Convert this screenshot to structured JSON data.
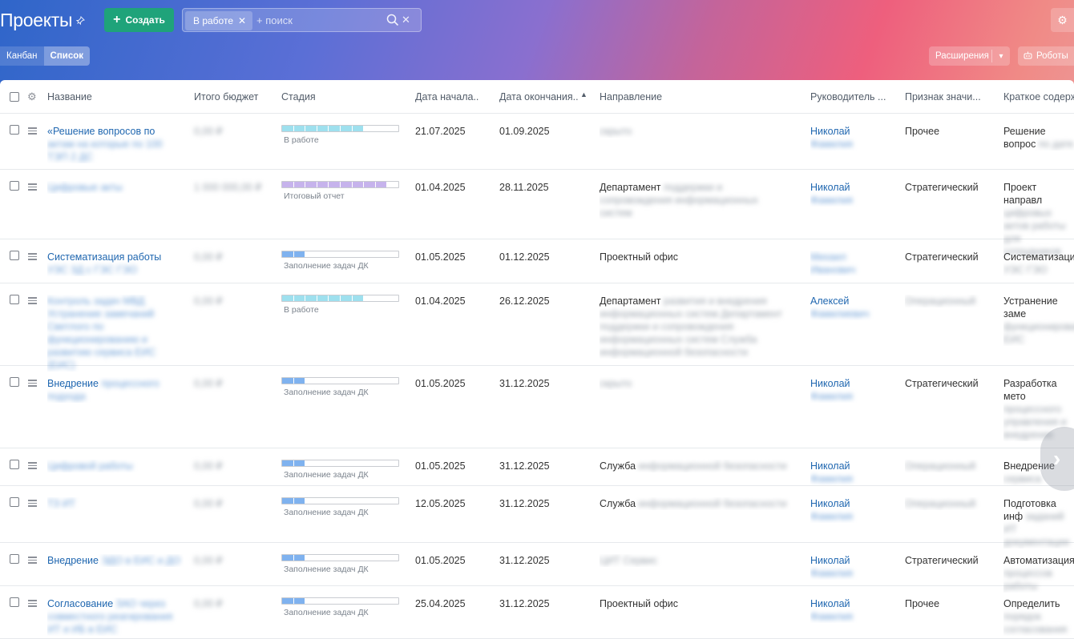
{
  "header": {
    "title": "Проекты",
    "create_label": "Создать",
    "filter_tag": "В работе",
    "search_placeholder": "+ поиск",
    "views": [
      "Канбан",
      "Список"
    ],
    "extensions_label": "Расширения",
    "robots_label": "Роботы"
  },
  "colors": {
    "accent_create": "#1fa37a",
    "link": "#2067b0",
    "stage_work": "#9ee0ee",
    "stage_report": "#c6b3ec",
    "stage_fill": "#7fb2ef"
  },
  "table": {
    "columns": [
      "Название",
      "Итого бюджет",
      "Стадия",
      "Дата начала...",
      "Дата окончания...",
      "Направление",
      "Руководитель ...",
      "Признак значи...",
      "Краткое содерж"
    ],
    "rows": [
      {
        "name": "«Решение вопросов по",
        "name_hidden": "актам на которые по 100 ТЭП 2 ДС",
        "budget": "0,00 ₽",
        "stage": "В работе",
        "start": "21.07.2025",
        "end": "01.09.2025",
        "direction": "",
        "direction_hidden": "скрыто",
        "manager": "Николай",
        "manager_hidden": "Фамилия",
        "sign": "Прочее",
        "summary": "Решение вопрос",
        "summary_hidden": "по дате"
      },
      {
        "name": "",
        "name_hidden": "Цифровые акты",
        "budget": "1 000 000,00 ₽",
        "stage": "Итоговый отчет",
        "start": "01.04.2025",
        "end": "28.11.2025",
        "direction": "Департамент",
        "direction_hidden": "поддержки и сопровождения информационных систем",
        "manager": "Николай",
        "manager_hidden": "Фамилия",
        "sign": "Стратегический",
        "summary": "Проект направл",
        "summary_hidden": "цифровых актов работы для сотрудников"
      },
      {
        "name": "Систематизация работы",
        "name_hidden": "УЭС ЗД с ГЭС ГЭО",
        "budget": "0,00 ₽",
        "stage": "Заполнение задач ДК",
        "start": "01.05.2025",
        "end": "01.12.2025",
        "direction": "Проектный офис",
        "direction_hidden": "",
        "manager": "",
        "manager_hidden": "Михаил Иванович",
        "sign": "Стратегический",
        "summary": "Систематизация",
        "summary_hidden": "УЭС ГЭО"
      },
      {
        "name": "",
        "name_hidden": "Контроль задач МВД Устранение замечаний Светлого по функционированию и развитию сервиса ЕИС (ЕИС)",
        "budget": "0,00 ₽",
        "stage": "В работе",
        "start": "01.04.2025",
        "end": "26.12.2025",
        "direction": "Департамент",
        "direction_hidden": "развития и внедрения информационных систем Департамент поддержки и сопровождения информационных систем Служба информационной безопасности",
        "manager": "Алексей",
        "manager_hidden": "Фамилиевич",
        "sign": "",
        "sign_hidden": "Операционный",
        "summary": "Устранение заме",
        "summary_hidden": "функционирования ЕИС"
      },
      {
        "name": "Внедрение",
        "name_hidden": "процессного подхода",
        "budget": "0,00 ₽",
        "stage": "Заполнение задач ДК",
        "start": "01.05.2025",
        "end": "31.12.2025",
        "direction": "",
        "direction_hidden": "скрыто",
        "manager": "Николай",
        "manager_hidden": "Фамилия",
        "sign": "Стратегический",
        "summary": "Разработка мето",
        "summary_hidden": "процессного управления и внедрение"
      },
      {
        "name": "",
        "name_hidden": "Цифровой работы",
        "budget": "0,00 ₽",
        "stage": "Заполнение задач ДК",
        "start": "01.05.2025",
        "end": "31.12.2025",
        "direction": "Служба",
        "direction_hidden": "информационной безопасности",
        "manager": "Николай",
        "manager_hidden": "Фамилия",
        "sign": "",
        "sign_hidden": "Операционный",
        "summary": "Внедрение",
        "summary_hidden": "сервиса"
      },
      {
        "name": "",
        "name_hidden": "ТЗ ИТ",
        "budget": "0,00 ₽",
        "stage": "Заполнение задач ДК",
        "start": "12.05.2025",
        "end": "31.12.2025",
        "direction": "Служба",
        "direction_hidden": "информационной безопасности",
        "manager": "Николай",
        "manager_hidden": "Фамилия",
        "sign": "",
        "sign_hidden": "Операционный",
        "summary": "Подготовка инф",
        "summary_hidden": "заданий ИТ документации"
      },
      {
        "name": "Внедрение",
        "name_hidden": "ЭДО в ЕИС и ДО",
        "budget": "0,00 ₽",
        "stage": "Заполнение задач ДК",
        "start": "01.05.2025",
        "end": "31.12.2025",
        "direction": "",
        "direction_hidden": "ЦИТ Сервис",
        "manager": "Николай",
        "manager_hidden": "Фамилия",
        "sign": "Стратегический",
        "summary": "Автоматизация",
        "summary_hidden": "процессов работы"
      },
      {
        "name": "Согласование",
        "name_hidden": "ЗАО через совместного реагирования ИТ и ИБ в ЕИС",
        "budget": "0,00 ₽",
        "stage": "Заполнение задач ДК",
        "start": "25.04.2025",
        "end": "31.12.2025",
        "direction": "Проектный офис",
        "direction_hidden": "",
        "manager": "Николай",
        "manager_hidden": "Фамилия",
        "sign": "Прочее",
        "summary": "Определить",
        "summary_hidden": "порядок согласования"
      }
    ]
  },
  "stage_fill": [
    {
      "stage": "В работе",
      "fill": 0.7
    },
    {
      "stage": "Итоговый отчет",
      "fill": 0.9
    },
    {
      "stage": "Заполнение задач ДК",
      "fill": 0.2
    }
  ]
}
